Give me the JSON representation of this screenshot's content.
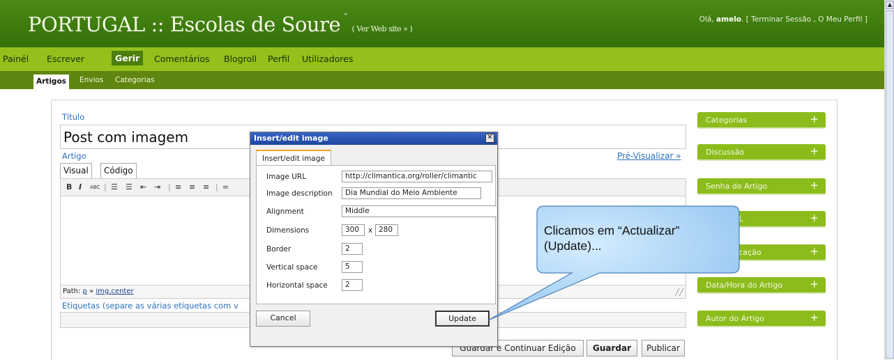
{
  "header": {
    "title": "PORTUGAL :: Escolas de Soure",
    "dropdown_icon": "chevron-down-icon",
    "view_site": "( Ver Web site » )",
    "greeting": "Olá,",
    "username": "amelo",
    "user_links": ". [ Terminar Sessão , O Meu Perfil ]"
  },
  "main_nav": [
    "Painél",
    "Escrever",
    "Gerir",
    "Comentários",
    "Blogroll",
    "Perfil",
    "Utilizadores"
  ],
  "main_nav_active": "Gerir",
  "sub_nav": [
    "Artigos",
    "Envios",
    "Categorias"
  ],
  "post": {
    "title_label": "Título",
    "title_value": "Post com imagem",
    "content_label": "Artigo",
    "preview_link": "Pré-Visualizar »",
    "tab_visual": "Visual",
    "tab_code": "Código",
    "path_label": "Path:",
    "path_p": "p",
    "path_sep": "»",
    "path_img": "img.center",
    "tags_label": "Etiquetas (separe as várias etiquetas com v"
  },
  "actions": {
    "save_continue": "Guardar e Continuar Edição",
    "save": "Guardar",
    "publish": "Publicar"
  },
  "sidebar": [
    "Categorias",
    "Discussão",
    "Senha do Artigo",
    "...ara URL",
    "...e Publicação",
    "Data/Hora do Artigo",
    "Autor do Artigo"
  ],
  "sidebar_plus": "+",
  "dialog": {
    "title": "Insert/edit image",
    "close": "✕",
    "tab": "Insert/edit image",
    "fields": {
      "url_label": "Image URL",
      "url_value": "http://climantica.org/roller/climantic",
      "desc_label": "Image description",
      "desc_value": "Dia Mundial do Meio Ambiente",
      "align_label": "Alignment",
      "align_value": "Middle",
      "dim_label": "Dimensions",
      "width": "300",
      "times": "x",
      "height": "280",
      "border_label": "Border",
      "border_value": "2",
      "vspace_label": "Vertical space",
      "vspace_value": "5",
      "hspace_label": "Horizontal space",
      "hspace_value": "2"
    },
    "cancel": "Cancel",
    "update": "Update"
  },
  "callout": {
    "line1": "Clicamos em “Actualizar”",
    "line2": "(Update)..."
  },
  "colors": {
    "header": "#3d7a0e",
    "main_nav": "#94c01c",
    "sub_nav": "#5f8610",
    "sidebar_box": "#8cbc1c",
    "link": "#2a6fbc",
    "callout_fill": "#a8d2f5"
  }
}
